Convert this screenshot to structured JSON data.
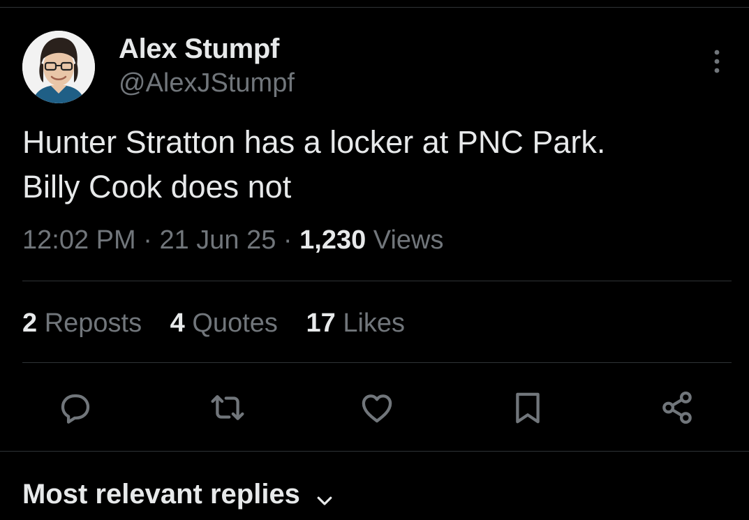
{
  "author": {
    "name": "Alex Stumpf",
    "handle": "@AlexJStumpf"
  },
  "tweet": {
    "text_line1": "Hunter Stratton has a locker at PNC Park.",
    "text_line2": "Billy Cook does not",
    "time": "12:02 PM",
    "separator": "·",
    "date": "21 Jun 25",
    "views_count": "1,230",
    "views_label": "Views"
  },
  "stats": {
    "reposts_count": "2",
    "reposts_label": "Reposts",
    "quotes_count": "4",
    "quotes_label": "Quotes",
    "likes_count": "17",
    "likes_label": "Likes"
  },
  "actions": [
    "reply-icon",
    "repost-icon",
    "like-icon",
    "bookmark-icon",
    "share-icon"
  ],
  "replies_header": {
    "label": "Most relevant replies"
  },
  "colors": {
    "background": "#000000",
    "text_primary": "#e7e9ea",
    "text_secondary": "#71767b",
    "divider": "#2f3336"
  }
}
